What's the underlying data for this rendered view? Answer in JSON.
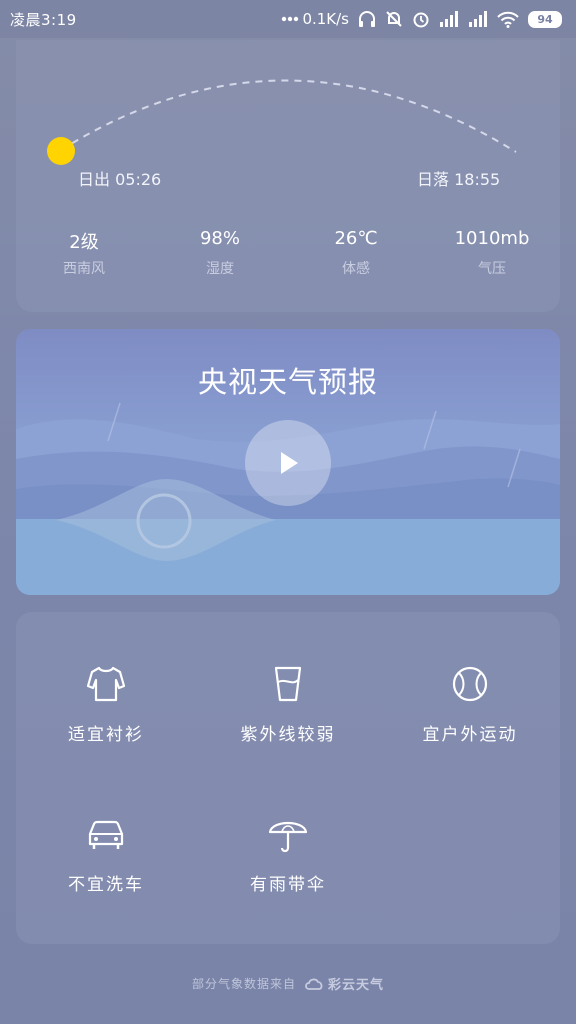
{
  "status_bar": {
    "time": "凌晨3:19",
    "network_speed": "0.1K/s",
    "battery": "94",
    "icons": [
      "more-dots-icon",
      "headphones-icon",
      "notifications-off-icon",
      "alarm-icon",
      "signal-icon",
      "signal-icon",
      "wifi-icon",
      "battery-icon"
    ]
  },
  "sun": {
    "sunrise": "日出 05:26",
    "sunset": "日落 18:55",
    "sun_color": "#FFD400"
  },
  "stats": [
    {
      "value": "2级",
      "label": "西南风"
    },
    {
      "value": "98%",
      "label": "湿度"
    },
    {
      "value": "26℃",
      "label": "体感"
    },
    {
      "value": "1010mb",
      "label": "气压"
    }
  ],
  "video": {
    "title": "央视天气预报",
    "play_icon": "play-icon"
  },
  "tips": [
    {
      "label": "适宜衬衫",
      "icon": "shirt-icon"
    },
    {
      "label": "紫外线较弱",
      "icon": "cup-icon"
    },
    {
      "label": "宜户外运动",
      "icon": "ball-icon"
    },
    {
      "label": "不宜洗车",
      "icon": "car-icon"
    },
    {
      "label": "有雨带伞",
      "icon": "umbrella-icon"
    }
  ],
  "footer": {
    "text": "部分气象数据来自",
    "brand": "彩云天气"
  }
}
